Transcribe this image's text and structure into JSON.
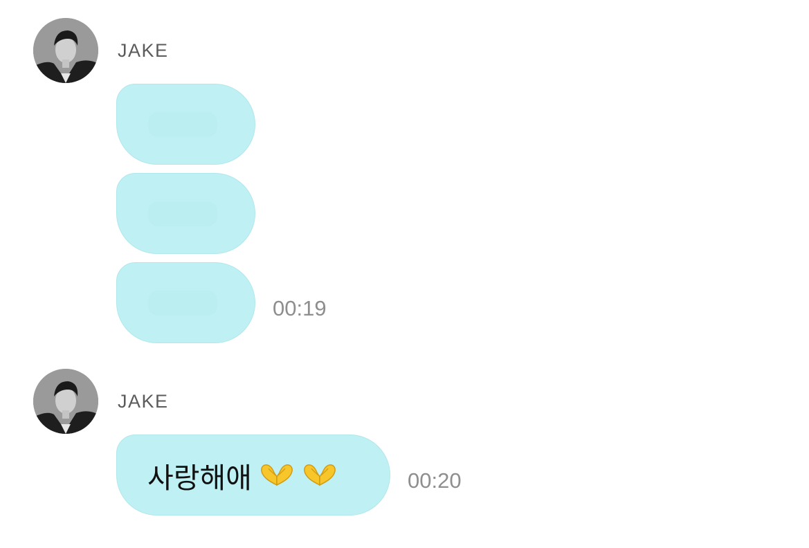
{
  "messages": [
    {
      "sender": "JAKE",
      "avatar_icon": "profile-photo",
      "bubbles": [
        {
          "text": "",
          "redacted": true
        },
        {
          "text": "",
          "redacted": true
        },
        {
          "text": "",
          "redacted": true
        }
      ],
      "time": "00:19"
    },
    {
      "sender": "JAKE",
      "avatar_icon": "profile-photo",
      "bubbles": [
        {
          "text": "사랑해애",
          "emoji": [
            "heart-hands-emoji",
            "heart-hands-emoji"
          ]
        }
      ],
      "time": "00:20"
    }
  ],
  "colors": {
    "bubble": "#bff1f4",
    "sender_text": "#5b5b5b",
    "time_text": "#8e8e8e"
  }
}
